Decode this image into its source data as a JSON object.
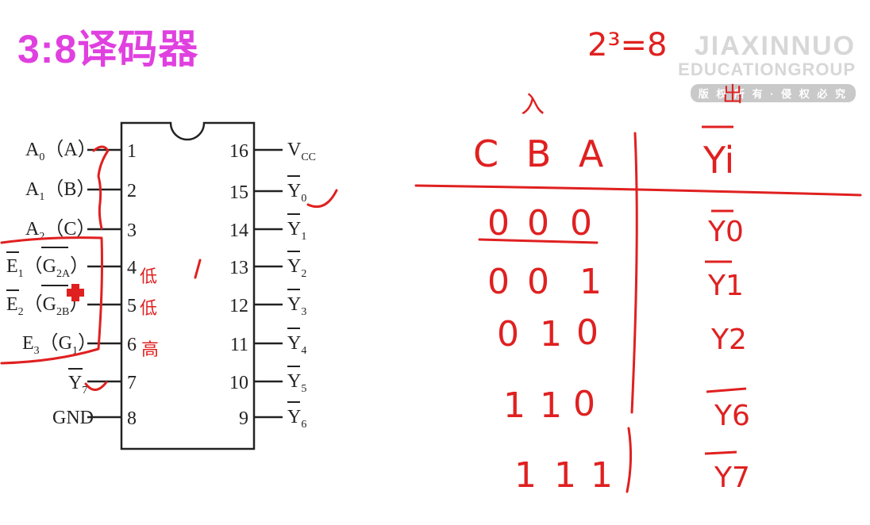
{
  "title": "3:8译码器",
  "watermark": {
    "line1": "JIAXINNUO",
    "line2": "EDUCATIONGROUP",
    "line3": "版 权 所 有 · 侵 权 必 究"
  },
  "chip": {
    "left_pins": [
      {
        "num": "1",
        "label": "A",
        "sub": "0",
        "alt": "（A）"
      },
      {
        "num": "2",
        "label": "A",
        "sub": "1",
        "alt": "（B）"
      },
      {
        "num": "3",
        "label": "A",
        "sub": "2",
        "alt": "（C）"
      },
      {
        "num": "4",
        "label": "E",
        "sub": "1",
        "alt": "（G",
        "alt_sub": "2A",
        "alt_end": "）"
      },
      {
        "num": "5",
        "label": "E",
        "sub": "2",
        "alt": "（G",
        "alt_sub": "2B",
        "alt_end": "）"
      },
      {
        "num": "6",
        "label": "E",
        "sub": "3",
        "alt": "（G",
        "alt_sub": "1",
        "alt_end": "）"
      },
      {
        "num": "7",
        "label": "Y",
        "sub": "7",
        "alt": ""
      },
      {
        "num": "8",
        "label": "GND",
        "sub": "",
        "alt": ""
      }
    ],
    "right_pins": [
      {
        "num": "16",
        "label": "V",
        "sub": "CC"
      },
      {
        "num": "15",
        "label": "Y",
        "sub": "0"
      },
      {
        "num": "14",
        "label": "Y",
        "sub": "1"
      },
      {
        "num": "13",
        "label": "Y",
        "sub": "2"
      },
      {
        "num": "12",
        "label": "Y",
        "sub": "3"
      },
      {
        "num": "11",
        "label": "Y",
        "sub": "4"
      },
      {
        "num": "10",
        "label": "Y",
        "sub": "5"
      },
      {
        "num": "9",
        "label": "Y",
        "sub": "6"
      }
    ],
    "pin_notes": {
      "p4": "低",
      "p5": "低",
      "p6": "高"
    }
  },
  "handwriting": {
    "formula": "2³=8",
    "input_note": "入",
    "output_note": "出",
    "headers": {
      "inputs": "C B A",
      "outputs": "Yi"
    },
    "rows": [
      {
        "bits": [
          "0",
          "0",
          "0"
        ],
        "out": "Y0"
      },
      {
        "bits": [
          "0",
          "0",
          "1"
        ],
        "out": "Y1"
      },
      {
        "bits": [
          "0",
          "1",
          "0"
        ],
        "out": "Y2"
      },
      {
        "bits": [
          "1",
          "1",
          "0"
        ],
        "out": "Y6"
      },
      {
        "bits": [
          "1",
          "1",
          "1"
        ],
        "out": "Y7"
      }
    ]
  }
}
